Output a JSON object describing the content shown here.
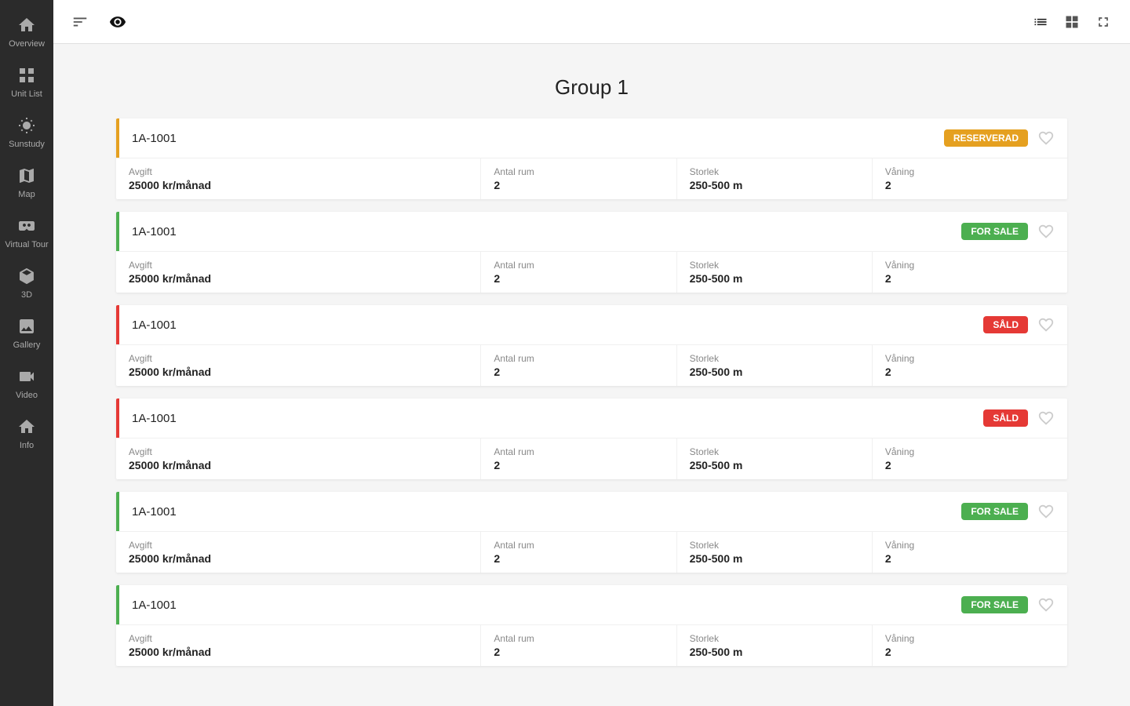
{
  "sidebar": {
    "items": [
      {
        "id": "overview",
        "label": "Overview",
        "icon": "home"
      },
      {
        "id": "unit-list",
        "label": "Unit List",
        "icon": "grid"
      },
      {
        "id": "sunstudy",
        "label": "Sunstudy",
        "icon": "sun"
      },
      {
        "id": "map",
        "label": "Map",
        "icon": "map"
      },
      {
        "id": "virtual-tour",
        "label": "Virtual Tour",
        "icon": "vr"
      },
      {
        "id": "3d",
        "label": "3D",
        "icon": "cube"
      },
      {
        "id": "gallery",
        "label": "Gallery",
        "icon": "image"
      },
      {
        "id": "video",
        "label": "Video",
        "icon": "video"
      },
      {
        "id": "info",
        "label": "Info",
        "icon": "info"
      }
    ]
  },
  "toolbar": {
    "filter_label": "filter",
    "view_label": "view"
  },
  "main": {
    "group_title": "Group 1",
    "units": [
      {
        "name": "1A-1001",
        "status": "RESERVERAD",
        "status_type": "reserverad",
        "avgift_label": "Avgift",
        "avgift_value": "25000 kr/månad",
        "antal_label": "Antal rum",
        "antal_value": "2",
        "storlek_label": "Storlek",
        "storlek_value": "250-500 m",
        "vaning_label": "Våning",
        "vaning_value": "2"
      },
      {
        "name": "1A-1001",
        "status": "FOR SALE",
        "status_type": "forsale",
        "avgift_label": "Avgift",
        "avgift_value": "25000 kr/månad",
        "antal_label": "Antal rum",
        "antal_value": "2",
        "storlek_label": "Storlek",
        "storlek_value": "250-500 m",
        "vaning_label": "Våning",
        "vaning_value": "2"
      },
      {
        "name": "1A-1001",
        "status": "SÅLD",
        "status_type": "sold",
        "avgift_label": "Avgift",
        "avgift_value": "25000 kr/månad",
        "antal_label": "Antal rum",
        "antal_value": "2",
        "storlek_label": "Storlek",
        "storlek_value": "250-500 m",
        "vaning_label": "Våning",
        "vaning_value": "2"
      },
      {
        "name": "1A-1001",
        "status": "SÅLD",
        "status_type": "sold",
        "avgift_label": "Avgift",
        "avgift_value": "25000 kr/månad",
        "antal_label": "Antal rum",
        "antal_value": "2",
        "storlek_label": "Storlek",
        "storlek_value": "250-500 m",
        "vaning_label": "Våning",
        "vaning_value": "2"
      },
      {
        "name": "1A-1001",
        "status": "FOR SALE",
        "status_type": "forsale",
        "avgift_label": "Avgift",
        "avgift_value": "25000 kr/månad",
        "antal_label": "Antal rum",
        "antal_value": "2",
        "storlek_label": "Storlek",
        "storlek_value": "250-500 m",
        "vaning_label": "Våning",
        "vaning_value": "2"
      },
      {
        "name": "1A-1001",
        "status": "FOR SALE",
        "status_type": "forsale",
        "avgift_label": "Avgift",
        "avgift_value": "25000 kr/månad",
        "antal_label": "Antal rum",
        "antal_value": "2",
        "storlek_label": "Storlek",
        "storlek_value": "250-500 m",
        "vaning_label": "Våning",
        "vaning_value": "2"
      }
    ]
  }
}
